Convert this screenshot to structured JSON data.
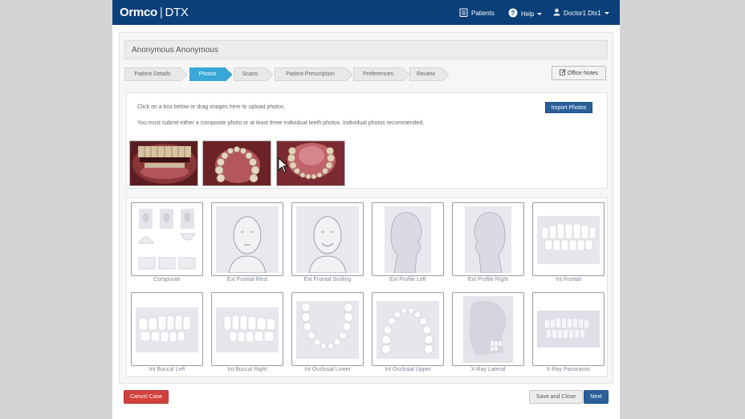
{
  "header": {
    "brand": "Ormco",
    "separator": "|",
    "product": "DTX",
    "patients_label": "Patients",
    "patients_icon": "clipboard-icon",
    "help_label": "Help",
    "help_icon": "question-circle-icon",
    "user_label": "Doctor1 Dtx1",
    "user_icon": "user-icon",
    "bar_color": "#0b3f7a"
  },
  "patient": {
    "name": "Anonymous Anonymous"
  },
  "steps": [
    {
      "label": "Patient Details",
      "active": false
    },
    {
      "label": "Photos",
      "active": true
    },
    {
      "label": "Scans",
      "active": false
    },
    {
      "label": "Patient Prescription",
      "active": false
    },
    {
      "label": "Preferences",
      "active": false
    },
    {
      "label": "Review",
      "active": false
    }
  ],
  "office_notes": {
    "label": "Office Notes",
    "icon": "edit-icon"
  },
  "upload": {
    "instruction_1": "Click on a box below or drag images here to upload photos.",
    "instruction_2": "You must submit either a composite photo or at least three individual teeth photos. Individual photos recommended.",
    "import_label": "Import Photos",
    "thumbnails": [
      "uploaded-photo-frontal-teeth",
      "uploaded-photo-upper-arch",
      "uploaded-photo-lower-arch"
    ]
  },
  "photo_slots": [
    {
      "label": "Composite"
    },
    {
      "label": "Ext Frontal Rest"
    },
    {
      "label": "Ext Frontal Smiling"
    },
    {
      "label": "Ext Profile Left"
    },
    {
      "label": "Ext Profile Right"
    },
    {
      "label": "Int Frontal"
    },
    {
      "label": "Int Buccal Left"
    },
    {
      "label": "Int Buccal Right"
    },
    {
      "label": "Int Occlusal Lower"
    },
    {
      "label": "Int Occlusal Upper"
    },
    {
      "label": "X-Ray Lateral"
    },
    {
      "label": "X-Ray Panoramic"
    }
  ],
  "footer": {
    "cancel_label": "Cancel Case",
    "save_close_label": "Save and Close",
    "next_label": "Next"
  },
  "colors": {
    "accent_active_step": "#3aa7d6",
    "primary_button": "#2b5f9a",
    "danger_button": "#d0403c"
  }
}
